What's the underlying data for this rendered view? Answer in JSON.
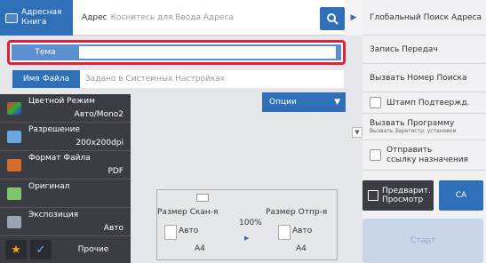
{
  "header": {
    "address_book_label": "Адресная Книга",
    "address_label": "Адрес",
    "address_placeholder": "Коснитесь для Ввода Адреса",
    "global_search": "Глобальный Поиск Адреса"
  },
  "fields": {
    "subject_label": "Тема",
    "subject_value": "",
    "filename_label": "Имя Файла",
    "filename_placeholder": "Задано в Системных Настройках",
    "options_label": "Опции"
  },
  "settings": [
    {
      "title": "Цветной Режим",
      "value": "Авто/Mono2"
    },
    {
      "title": "Разрешение",
      "value": "200x200dpi"
    },
    {
      "title": "Формат Файла",
      "value": "PDF"
    },
    {
      "title": "Оригинал",
      "value": ""
    },
    {
      "title": "Экспозиция",
      "value": "Авто"
    }
  ],
  "bottom": {
    "other_label": "Прочие"
  },
  "size": {
    "scan_label": "Размер Скан-я",
    "send_label": "Размер Отпр-я",
    "scan_mode": "Авто",
    "scan_size": "A4",
    "ratio": "100%",
    "send_mode": "Авто",
    "send_size": "A4"
  },
  "right": {
    "send_log": "Запись Передач",
    "recall_search": "Вызвать Номер Поиска",
    "stamp": "Штамп Подтвержд.",
    "recall_program": "Вызвать Программу",
    "recall_program_sub": "Вызвать Зарегистр. установки",
    "send_link_line1": "Отправить",
    "send_link_line2": "ссылку назначения",
    "preview_line1": "Предварит.",
    "preview_line2": "Просмотр",
    "ca": "CA",
    "start": "Старт"
  },
  "colors": {
    "accent": "#2f6fb8",
    "highlight": "#e01f3a",
    "dark": "#3a3d44"
  }
}
